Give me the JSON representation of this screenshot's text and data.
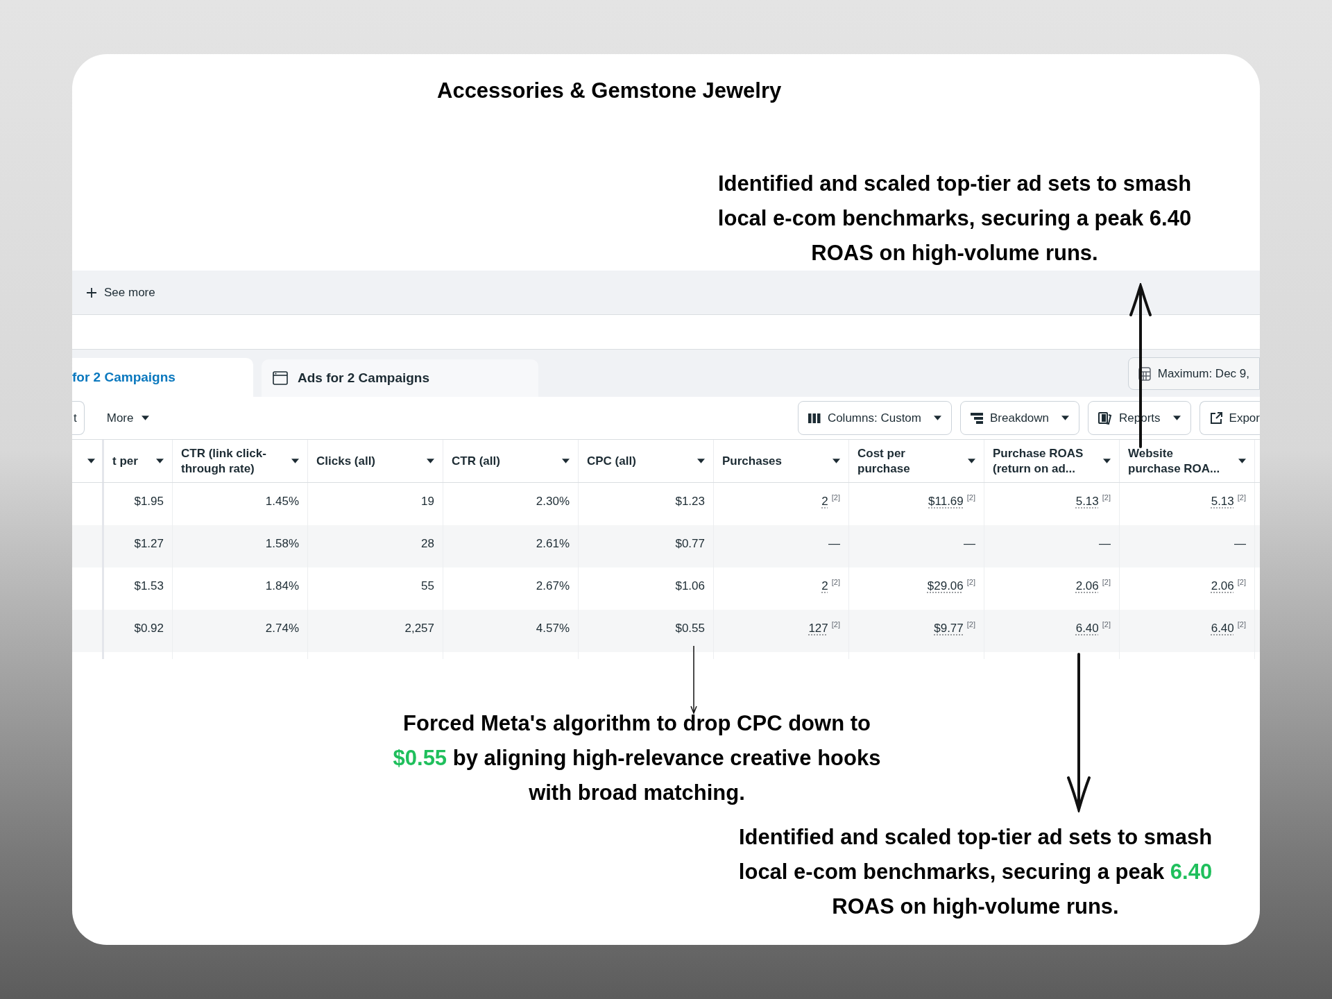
{
  "title": "Accessories & Gemstone Jewelry",
  "top_note": {
    "lines": [
      [
        {
          "text": "Identified and scaled top-tier ad sets to smash",
          "highlight": false
        }
      ],
      [
        {
          "text": "local e-com benchmarks, securing a peak 6.40",
          "highlight": false
        }
      ],
      [
        {
          "text": "ROAS on high-volume runs.",
          "highlight": false
        }
      ]
    ]
  },
  "see_more": "See more",
  "tabs": [
    {
      "label": "for 2 Campaigns",
      "selected": true
    },
    {
      "label": "Ads for 2 Campaigns",
      "selected": false
    }
  ],
  "date_range": "Maximum: Dec 9,",
  "toolbar_left": [
    {
      "label": "t",
      "kind": "button"
    },
    {
      "label": "More",
      "kind": "text-dropdown"
    }
  ],
  "toolbar_right": [
    {
      "label": "Columns: Custom",
      "kind": "dropdown"
    },
    {
      "label": "Breakdown",
      "kind": "dropdown"
    },
    {
      "label": "Reports",
      "kind": "dropdown"
    },
    {
      "label": "Expor",
      "kind": "button"
    }
  ],
  "table": {
    "columns": [
      "t per",
      "CTR (link click-through rate)",
      "Clicks (all)",
      "CTR (all)",
      "CPC (all)",
      "Purchases",
      "Cost per purchase",
      "Purchase ROAS (return on ad...",
      "Website purchase ROA..."
    ],
    "rows": [
      {
        "cells": [
          {
            "value": "$1.95"
          },
          {
            "value": "1.45%"
          },
          {
            "value": "19"
          },
          {
            "value": "2.30%"
          },
          {
            "value": "$1.23"
          },
          {
            "value": "2",
            "note": "[2]"
          },
          {
            "value": "$11.69",
            "note": "[2]"
          },
          {
            "value": "5.13",
            "note": "[2]"
          },
          {
            "value": "5.13",
            "note": "[2]"
          }
        ]
      },
      {
        "cells": [
          {
            "value": "$1.27"
          },
          {
            "value": "1.58%"
          },
          {
            "value": "28"
          },
          {
            "value": "2.61%"
          },
          {
            "value": "$0.77"
          },
          {
            "value": "—"
          },
          {
            "value": "—"
          },
          {
            "value": "—"
          },
          {
            "value": "—"
          }
        ]
      },
      {
        "cells": [
          {
            "value": "$1.53"
          },
          {
            "value": "1.84%"
          },
          {
            "value": "55"
          },
          {
            "value": "2.67%"
          },
          {
            "value": "$1.06"
          },
          {
            "value": "2",
            "note": "[2]"
          },
          {
            "value": "$29.06",
            "note": "[2]"
          },
          {
            "value": "2.06",
            "note": "[2]"
          },
          {
            "value": "2.06",
            "note": "[2]"
          }
        ]
      },
      {
        "cells": [
          {
            "value": "$0.92"
          },
          {
            "value": "2.74%"
          },
          {
            "value": "2,257"
          },
          {
            "value": "4.57%"
          },
          {
            "value": "$0.55"
          },
          {
            "value": "127",
            "note": "[2]"
          },
          {
            "value": "$9.77",
            "note": "[2]"
          },
          {
            "value": "6.40",
            "note": "[2]"
          },
          {
            "value": "6.40",
            "note": "[2]"
          }
        ]
      }
    ]
  },
  "cpc_note": {
    "lines": [
      [
        {
          "text": "Forced Meta's algorithm to drop CPC down to",
          "highlight": false
        }
      ],
      [
        {
          "text": "$0.55",
          "highlight": true
        },
        {
          "text": " by aligning high-relevance creative hooks",
          "highlight": false
        }
      ],
      [
        {
          "text": "with broad matching.",
          "highlight": false
        }
      ]
    ]
  },
  "roas_note": {
    "lines": [
      [
        {
          "text": "Identified and scaled top-tier ad sets to smash",
          "highlight": false
        }
      ],
      [
        {
          "text": "local e-com benchmarks, securing a peak ",
          "highlight": false
        },
        {
          "text": "6.40",
          "highlight": true
        }
      ],
      [
        {
          "text": "ROAS on high-volume runs.",
          "highlight": false
        }
      ]
    ]
  }
}
